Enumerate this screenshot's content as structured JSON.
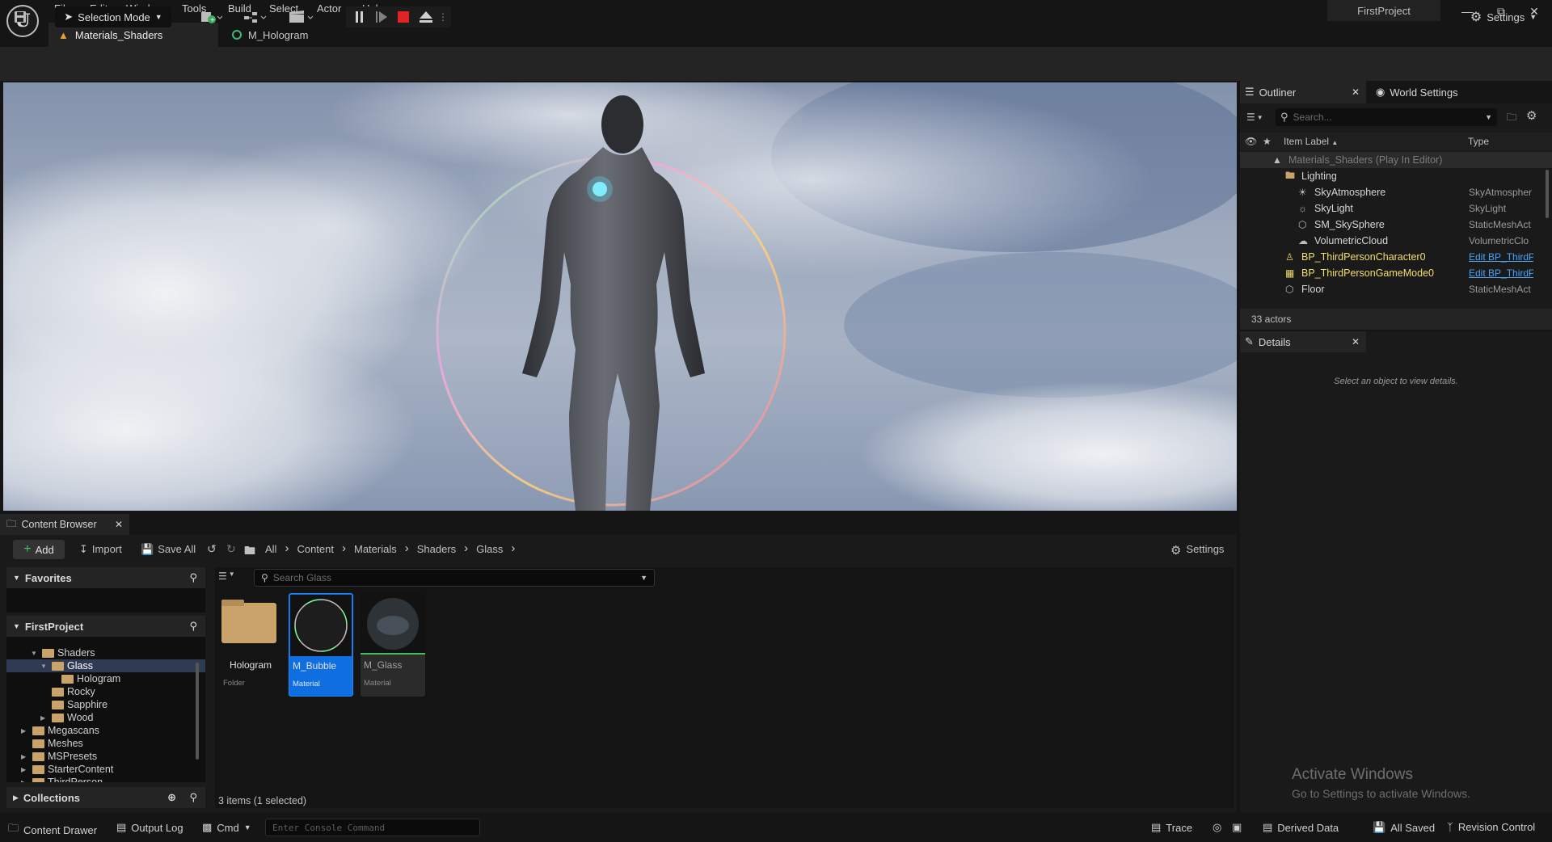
{
  "app": {
    "project_name": "FirstProject"
  },
  "menu": [
    "File",
    "Edit",
    "Window",
    "Tools",
    "Build",
    "Select",
    "Actor",
    "Help"
  ],
  "tabs": [
    {
      "label": "Materials_Shaders",
      "active": true
    },
    {
      "label": "M_Hologram",
      "active": false
    }
  ],
  "toolbar": {
    "selection_mode": "Selection Mode",
    "settings": "Settings"
  },
  "outliner": {
    "tab_label": "Outliner",
    "world_settings_tab": "World Settings",
    "search_placeholder": "Search...",
    "col_label": "Item Label",
    "col_type": "Type",
    "items": [
      {
        "label": "Materials_Shaders (Play In Editor)",
        "type": "",
        "indent": 0,
        "icon": "level-icon"
      },
      {
        "label": "Lighting",
        "type": "",
        "indent": 1,
        "icon": "folder-icon"
      },
      {
        "label": "SkyAtmosphere",
        "type": "SkyAtmospher",
        "indent": 2,
        "icon": "sky-atmosphere-icon"
      },
      {
        "label": "SkyLight",
        "type": "SkyLight",
        "indent": 2,
        "icon": "skylight-icon"
      },
      {
        "label": "SM_SkySphere",
        "type": "StaticMeshAct",
        "indent": 2,
        "icon": "static-mesh-icon"
      },
      {
        "label": "VolumetricCloud",
        "type": "VolumetricClo",
        "indent": 2,
        "icon": "cloud-icon"
      },
      {
        "label": "BP_ThirdPersonCharacter0",
        "type": "Edit BP_ThirdP",
        "indent": 1,
        "icon": "character-icon",
        "type_link": true,
        "highlight": true
      },
      {
        "label": "BP_ThirdPersonGameMode0",
        "type": "Edit BP_ThirdP",
        "indent": 1,
        "icon": "gamemode-icon",
        "type_link": true,
        "highlight": true
      },
      {
        "label": "Floor",
        "type": "StaticMeshAct",
        "indent": 1,
        "icon": "static-mesh-icon"
      }
    ],
    "actor_count": "33 actors"
  },
  "details": {
    "tab_label": "Details",
    "empty_text": "Select an object to view details."
  },
  "watermark": {
    "title": "Activate Windows",
    "subtitle": "Go to Settings to activate Windows."
  },
  "content_browser": {
    "tab_label": "Content Browser",
    "add": "Add",
    "import": "Import",
    "save_all": "Save All",
    "breadcrumbs": [
      "All",
      "Content",
      "Materials",
      "Shaders",
      "Glass"
    ],
    "settings": "Settings",
    "favorites": "Favorites",
    "project": "FirstProject",
    "collections": "Collections",
    "search_placeholder": "Search Glass",
    "tree": [
      {
        "label": "Shaders",
        "indent": 2,
        "open": true
      },
      {
        "label": "Glass",
        "indent": 3,
        "open": true,
        "selected": true
      },
      {
        "label": "Hologram",
        "indent": 4
      },
      {
        "label": "Rocky",
        "indent": 3
      },
      {
        "label": "Sapphire",
        "indent": 3
      },
      {
        "label": "Wood",
        "indent": 3,
        "collapsed": true
      },
      {
        "label": "Megascans",
        "indent": 1,
        "collapsed": true
      },
      {
        "label": "Meshes",
        "indent": 1
      },
      {
        "label": "MSPresets",
        "indent": 1,
        "collapsed": true
      },
      {
        "label": "StarterContent",
        "indent": 1,
        "collapsed": true
      },
      {
        "label": "ThirdPerson",
        "indent": 1,
        "collapsed": true
      }
    ],
    "assets": [
      {
        "name": "Hologram",
        "type": "Folder"
      },
      {
        "name": "M_Bubble",
        "type": "Material",
        "selected": true
      },
      {
        "name": "M_Glass",
        "type": "Material"
      }
    ],
    "item_count": "3 items (1 selected)"
  },
  "statusbar": {
    "content_drawer": "Content Drawer",
    "output_log": "Output Log",
    "cmd": "Cmd",
    "console_placeholder": "Enter Console Command",
    "trace": "Trace",
    "derived_data": "Derived Data",
    "all_saved": "All Saved",
    "revision_control": "Revision Control"
  }
}
